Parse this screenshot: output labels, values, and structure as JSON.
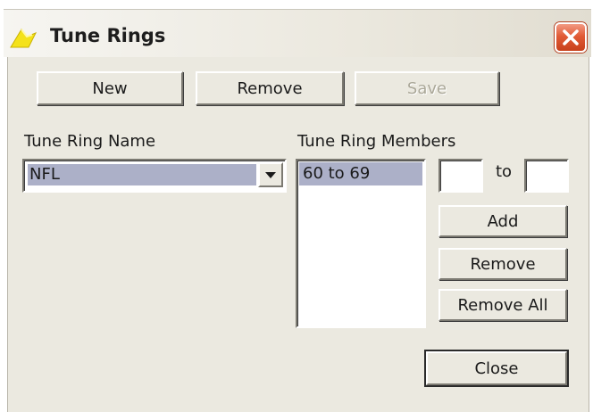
{
  "window": {
    "title": "Tune Rings",
    "close_icon": "close-x-icon",
    "app_icon": "yellow-arrow-icon"
  },
  "toolbar": {
    "new_label": "New",
    "remove_label": "Remove",
    "save_label": "Save",
    "save_enabled": false
  },
  "ring_name": {
    "label": "Tune Ring Name",
    "selected": "NFL"
  },
  "ring_members": {
    "label": "Tune Ring Members",
    "items": [
      "60 to 69"
    ]
  },
  "range": {
    "from_value": "",
    "to_label": "to",
    "to_value": ""
  },
  "member_buttons": {
    "add_label": "Add",
    "remove_label": "Remove",
    "remove_all_label": "Remove All"
  },
  "close_label": "Close",
  "colors": {
    "face": "#ebe9e0",
    "selection": "#acb0c8",
    "close_button": "#e15b36"
  }
}
